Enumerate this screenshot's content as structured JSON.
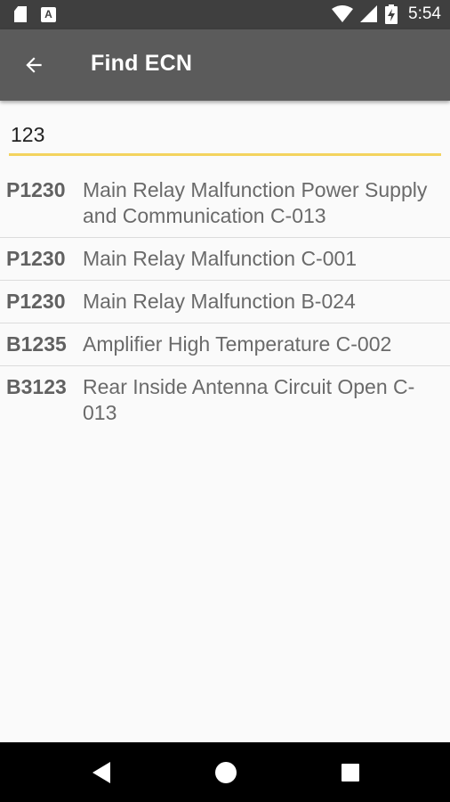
{
  "status_bar": {
    "time": "5:54",
    "left_icons": [
      "sd-card-icon",
      "a-notification-icon"
    ],
    "a_icon_text": "A",
    "right_icons": [
      "wifi-icon",
      "cellular-signal-icon",
      "battery-charging-icon"
    ]
  },
  "app_bar": {
    "title": "Find ECN",
    "back_icon": "arrow-back-icon"
  },
  "search": {
    "value": "123",
    "placeholder": ""
  },
  "results": [
    {
      "code": "P1230",
      "description": "Main Relay Malfunction Power Supply and Communication C-013"
    },
    {
      "code": "P1230",
      "description": "Main Relay Malfunction C-001"
    },
    {
      "code": "P1230",
      "description": "Main Relay Malfunction B-024"
    },
    {
      "code": "B1235",
      "description": "Amplifier High Temperature C-002"
    },
    {
      "code": "B3123",
      "description": "Rear Inside Antenna Circuit Open C-013"
    }
  ],
  "nav_bar": {
    "buttons": [
      "nav-back-icon",
      "nav-home-icon",
      "nav-recents-icon"
    ]
  },
  "colors": {
    "status_bar_bg": "#3f3f3f",
    "app_bar_bg": "#5b5b5b",
    "accent_underline": "#f3d35e",
    "background": "#fafafa",
    "nav_bar_bg": "#000000"
  }
}
